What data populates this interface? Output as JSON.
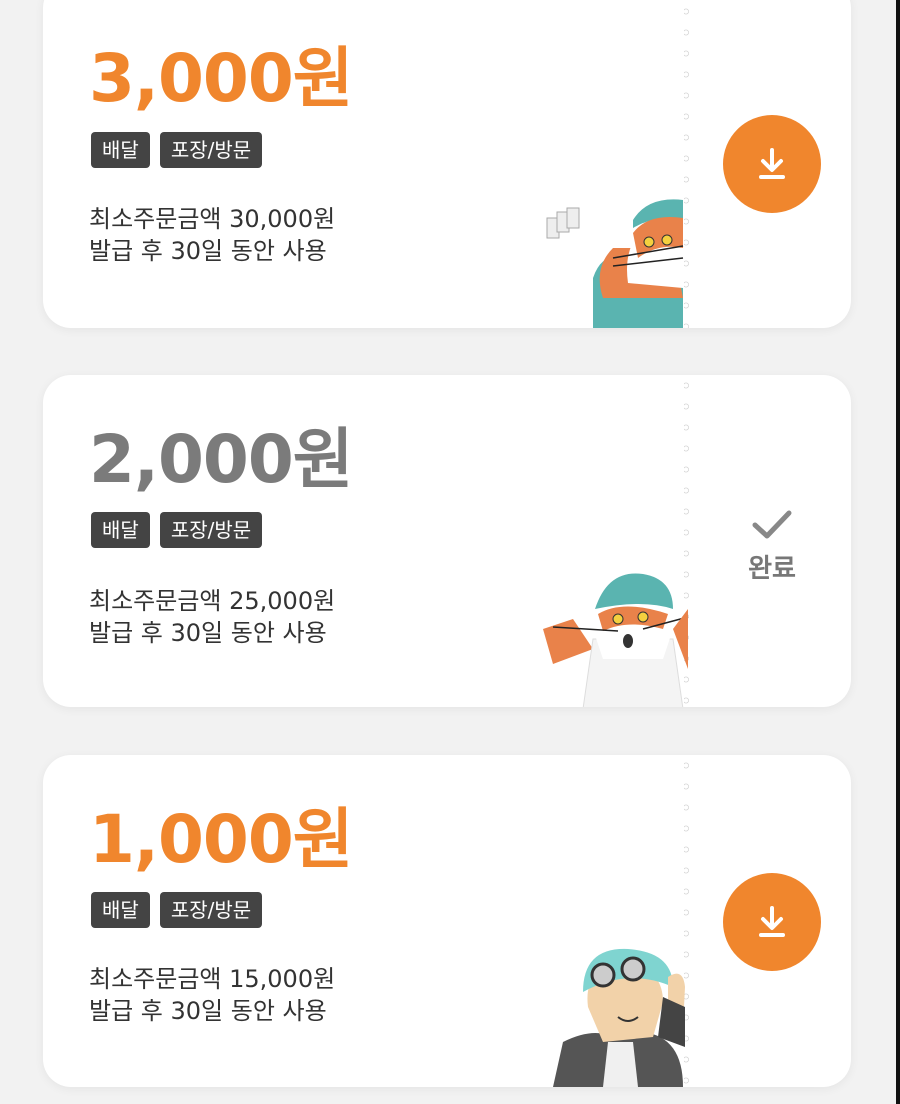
{
  "colors": {
    "accent": "#f0862d",
    "muted": "#7b7b7b",
    "tag_bg": "#444444"
  },
  "coupons": [
    {
      "amount": "3,000원",
      "tags": [
        "배달",
        "포장/방문"
      ],
      "min_order": "최소주문금액 30,000원",
      "validity": "발급 후 30일 동안 사용",
      "action": "download",
      "action_icon": "download-icon"
    },
    {
      "amount": "2,000원",
      "tags": [
        "배달",
        "포장/방문"
      ],
      "min_order": "최소주문금액 25,000원",
      "validity": "발급 후 30일 동안 사용",
      "action": "done",
      "action_icon": "check-icon",
      "done_label": "완료"
    },
    {
      "amount": "1,000원",
      "tags": [
        "배달",
        "포장/방문"
      ],
      "min_order": "최소주문금액 15,000원",
      "validity": "발급 후 30일 동안 사용",
      "action": "download",
      "action_icon": "download-icon"
    }
  ]
}
